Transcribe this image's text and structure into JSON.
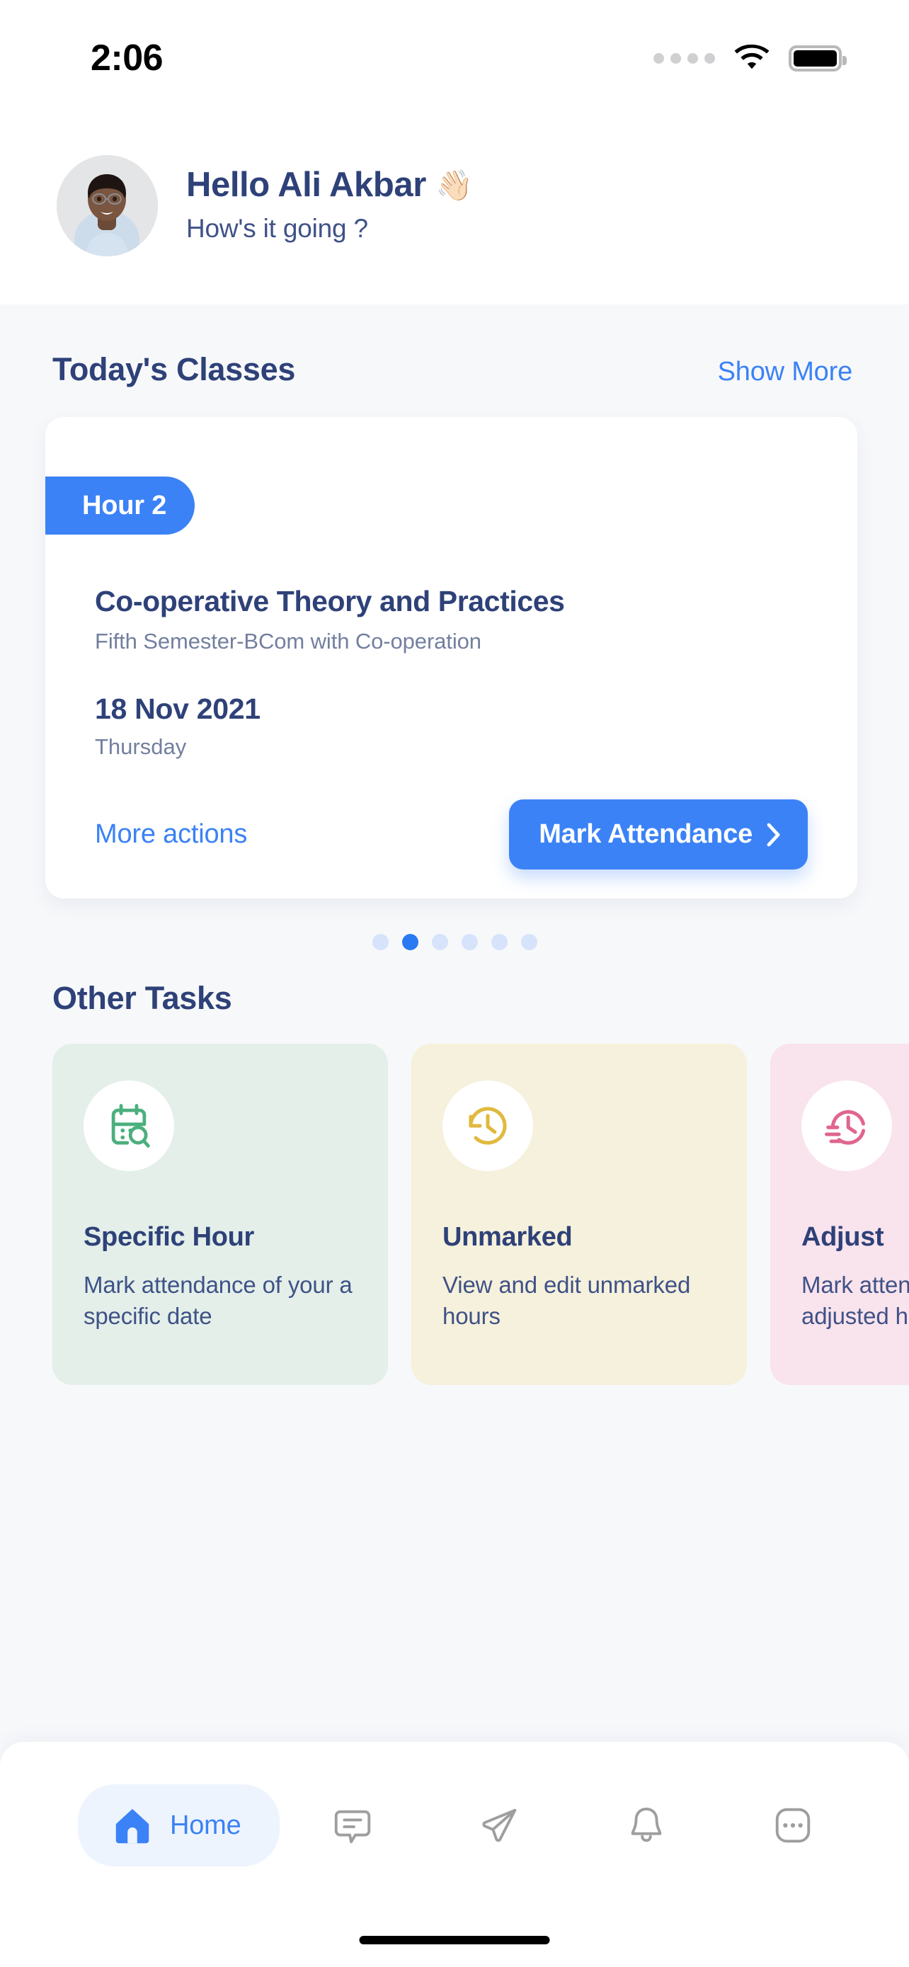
{
  "status_bar": {
    "time": "2:06",
    "signal_icon": "signal-dots-icon",
    "wifi_icon": "wifi-icon",
    "battery_icon": "battery-full-icon"
  },
  "header": {
    "avatar": "user-avatar-photo",
    "greeting": "Hello Ali Akbar",
    "wave_emoji": "👋🏻",
    "subtitle": "How's it going ?"
  },
  "todays_classes": {
    "title": "Today's Classes",
    "show_more": "Show More",
    "card": {
      "hour_badge": "Hour 2",
      "course_title": "Co-operative Theory and Practices",
      "course_subtitle": "Fifth Semester-BCom with Co-operation",
      "date": "18 Nov 2021",
      "day": "Thursday",
      "more_actions": "More actions",
      "primary_action": "Mark Attendance",
      "chevron_icon": "chevron-right-icon"
    },
    "pagination": {
      "total": 6,
      "active_index": 1
    }
  },
  "other_tasks": {
    "title": "Other Tasks",
    "cards": [
      {
        "title": "Specific Hour",
        "description": "Mark attendance of your a specific date",
        "icon": "calendar-search-icon",
        "bg_color": "#e4efe9",
        "icon_color": "#4caf7d"
      },
      {
        "title": "Unmarked",
        "description": "View and edit unmarked hours",
        "icon": "clock-rotate-left-icon",
        "bg_color": "#f6f1dc",
        "icon_color": "#e0b93e"
      },
      {
        "title": "Adjust",
        "description": "Mark attendance of your adjusted hour",
        "icon": "clock-history-icon",
        "bg_color": "#f9e3ec",
        "icon_color": "#e0658f"
      }
    ]
  },
  "bottom_nav": {
    "items": [
      {
        "label": "Home",
        "icon": "home-icon",
        "active": true
      },
      {
        "label": "Messages",
        "icon": "chat-bubble-icon",
        "active": false
      },
      {
        "label": "Send",
        "icon": "paper-plane-icon",
        "active": false
      },
      {
        "label": "Notifications",
        "icon": "bell-icon",
        "active": false
      },
      {
        "label": "More",
        "icon": "more-dots-icon",
        "active": false
      }
    ]
  },
  "colors": {
    "accent_blue": "#3b82f6",
    "navy_text": "#2e4178",
    "muted_text": "#737f9e",
    "page_bg": "#f7f8fa"
  }
}
